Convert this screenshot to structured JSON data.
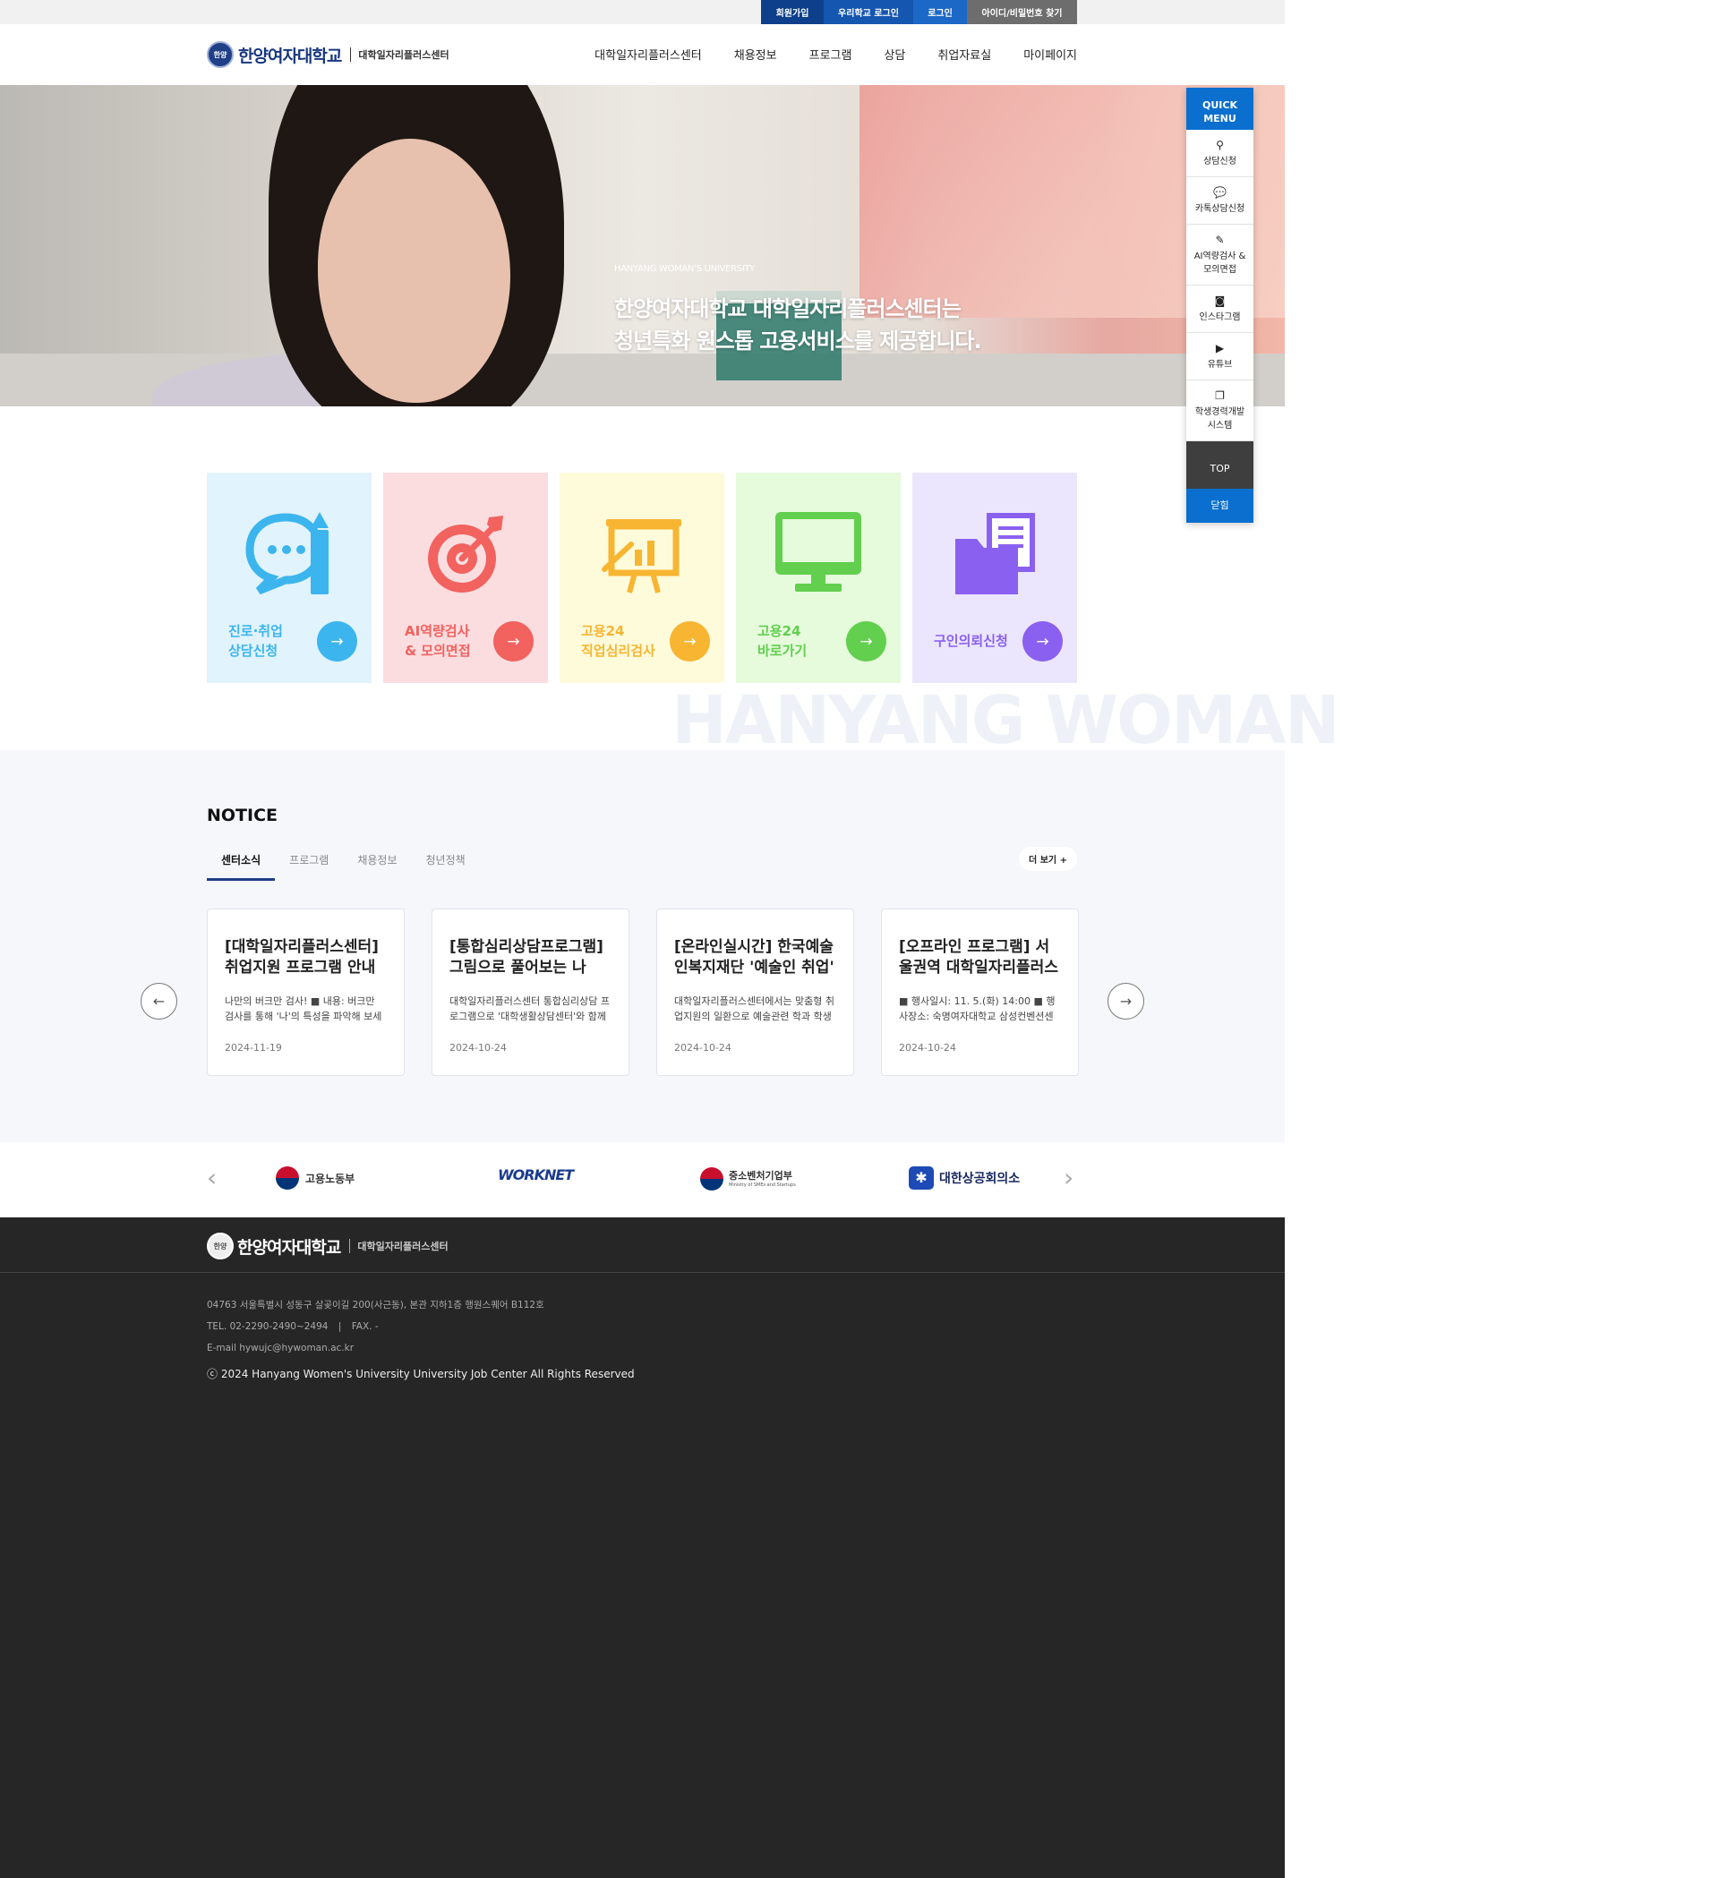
{
  "topbar": {
    "links": [
      {
        "label": "회원가입",
        "bg": "#0d3f8a"
      },
      {
        "label": "우리학교 로그인",
        "bg": "#1556b0"
      },
      {
        "label": "로그인",
        "bg": "#1b68c7"
      },
      {
        "label": "아이디/비밀번호 찾기",
        "bg": "#6d6d6d"
      }
    ]
  },
  "header": {
    "logo_seal": "한양",
    "logo_name": "한양여자대학교",
    "logo_sub": "대학일자리플러스센터",
    "nav": [
      "대학일자리플러스센터",
      "채용정보",
      "프로그램",
      "상담",
      "취업자료실",
      "마이페이지"
    ]
  },
  "hero": {
    "brand": "HANYANG WOMAN'S UNIVERSITY",
    "line1": "한양여자대학교 대학일자리플러스센터는",
    "line2": "청년특화 원스톱 고용서비스를 제공합니다."
  },
  "quick_menu": {
    "head1": "QUICK",
    "head2": "MENU",
    "items": [
      {
        "icon": "counsel-icon",
        "line1": "상담신청",
        "line2": ""
      },
      {
        "icon": "kakao-chat-icon",
        "line1": "카톡상담신청",
        "line2": ""
      },
      {
        "icon": "pencil-icon",
        "line1": "AI역량검사 &",
        "line2": "모의면접"
      },
      {
        "icon": "instagram-icon",
        "line1": "인스타그램",
        "line2": ""
      },
      {
        "icon": "youtube-icon",
        "line1": "유튜브",
        "line2": ""
      },
      {
        "icon": "document-icon",
        "line1": "학생경력개발",
        "line2": "시스템"
      }
    ],
    "top": "TOP",
    "close": "닫힘"
  },
  "cards": [
    {
      "line1": "진로·취업",
      "line2": "상담신청",
      "icon": "chat-pencil-icon",
      "bg": "#e1f3fd",
      "color": "#3cb5ee"
    },
    {
      "line1": "AI역량검사",
      "line2": "& 모의면접",
      "icon": "target-icon",
      "bg": "#fbdde0",
      "color": "#f2625f"
    },
    {
      "line1": "고용24",
      "line2": "직업심리검사",
      "icon": "presentation-icon",
      "bg": "#fefbdb",
      "color": "#f7b531"
    },
    {
      "line1": "고용24",
      "line2": "바로가기",
      "icon": "monitor-icon",
      "bg": "#e6fadc",
      "color": "#62cf4f"
    },
    {
      "line1": "구인의뢰신청",
      "line2": "",
      "icon": "folder-icon",
      "bg": "#ebe6fd",
      "color": "#8a60f0"
    }
  ],
  "watermark": "HANYANG WOMAN",
  "notice": {
    "title": "NOTICE",
    "tabs": [
      "센터소식",
      "프로그램",
      "채용정보",
      "청년정책"
    ],
    "more": "더 보기 +",
    "posts": [
      {
        "title": "[대학일자리플러스센터] 취업지원 프로그램 안내",
        "desc": "나만의 버크만 검사! ■ 내용: 버크만 검사를 통해 '나'의 특성을 파악해 보세요",
        "date": "2024-11-19"
      },
      {
        "title": "[통합심리상담프로그램] 그림으로 풀어보는 나",
        "desc": "대학일자리플러스센터 통합심리상담 프로그램으로 '대학생활상담센터'와 함께",
        "date": "2024-10-24"
      },
      {
        "title": "[온라인실시간] 한국예술인복지재단 '예술인 취업'",
        "desc": "대학일자리플러스센터에서는 맞춤형 취업지원의 일환으로 예술관련 학과 학생",
        "date": "2024-10-24"
      },
      {
        "title": "[오프라인 프로그램] 서울권역 대학일자리플러스센터",
        "desc": "■ 행사일시: 11. 5.(화) 14:00 ■ 행사장소: 숙명여자대학교 삼성컨벤션센터",
        "date": "2024-10-24"
      }
    ]
  },
  "partners": [
    {
      "name": "고용노동부",
      "sub": ""
    },
    {
      "name": "WORKNET",
      "sub": ""
    },
    {
      "name": "중소벤처기업부",
      "sub": "Ministry of SMEs and Startups"
    },
    {
      "name": "대한상공회의소",
      "sub": ""
    }
  ],
  "footer": {
    "logo_seal": "한양",
    "logo_name": "한양여자대학교",
    "logo_sub": "대학일자리플러스센터",
    "address": "04763 서울특별시 성동구 살곶이길 200(사근동), 본관 지하1층 행원스퀘어 B112호",
    "tel": "TEL. 02-2290-2490~2494",
    "fax": "FAX. -",
    "email": "E-mail hywujc@hywoman.ac.kr",
    "copyright": "ⓒ 2024 Hanyang Women's University University Job Center All Rights Reserved"
  }
}
